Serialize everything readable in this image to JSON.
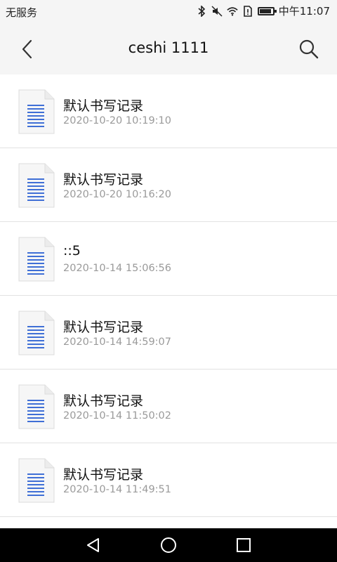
{
  "status_bar": {
    "carrier": "无服务",
    "time": "中午11:07",
    "battery_level": 0.9,
    "icons": [
      "bluetooth-icon",
      "mute-icon",
      "wifi-icon",
      "sim-alert-icon",
      "battery-icon"
    ]
  },
  "header": {
    "title": "ceshi 1111",
    "back_icon": "chevron-left-icon",
    "search_icon": "search-icon"
  },
  "files": [
    {
      "name": "默认书写记录",
      "date": "2020-10-20 10:19:10"
    },
    {
      "name": "默认书写记录",
      "date": "2020-10-20 10:16:20"
    },
    {
      "name": "::5",
      "date": "2020-10-14 15:06:56"
    },
    {
      "name": "默认书写记录",
      "date": "2020-10-14 14:59:07"
    },
    {
      "name": "默认书写记录",
      "date": "2020-10-14 11:50:02"
    },
    {
      "name": "默认书写记录",
      "date": "2020-10-14 11:49:51"
    }
  ],
  "nav_bar": {
    "icons": [
      "back-triangle-icon",
      "home-circle-icon",
      "recents-square-icon"
    ]
  },
  "colors": {
    "doc_lines": "#3f6fd6",
    "header_bg": "#f5f5f5",
    "divider": "#e2e2e2",
    "date_text": "#9a9a9a"
  }
}
